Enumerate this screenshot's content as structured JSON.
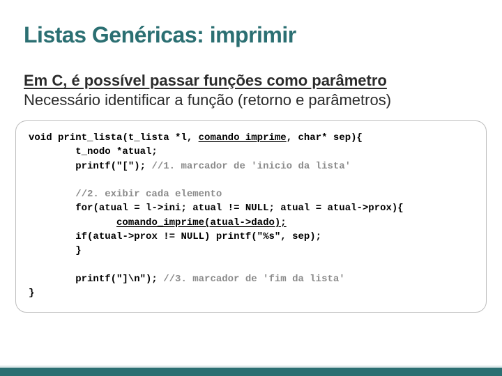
{
  "title": "Listas Genéricas: imprimir",
  "intro1": "Em C, é possível passar funções como parâmetro",
  "intro2": "Necessário identificar a função (retorno e parâmetros)",
  "code": {
    "l1a": "void",
    "l1b": " ",
    "l1c": "print_lista",
    "l1d": "(t_lista *l, ",
    "l1e": "comando imprime",
    "l1f": ", ",
    "l1g": "char",
    "l1h": "* sep){",
    "l2": "        t_nodo *atual;",
    "l3a": "        printf(\"[\"); ",
    "l3b": "//1. marcador de 'inicio da lista'",
    "l5": "        //2. exibir cada elemento",
    "l6a": "        ",
    "l6b": "for",
    "l6c": "(atual = l->ini; atual != NULL; atual = atual->prox){",
    "l7a": "               ",
    "l7b": "comando_imprime(atual->dado);",
    "l8a": "        ",
    "l8b": "if",
    "l8c": "(atual->prox != NULL) printf(\"%s\", sep);",
    "l9": "        }",
    "l11a": "        printf(\"]\\n\"); ",
    "l11b": "//3. marcador de 'fim da lista'",
    "l12": "}"
  }
}
